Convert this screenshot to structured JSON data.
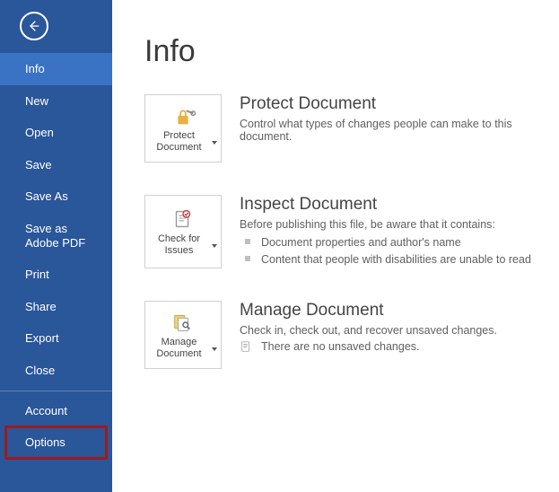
{
  "sidebar": {
    "items": [
      {
        "label": "Info",
        "selected": true
      },
      {
        "label": "New"
      },
      {
        "label": "Open"
      },
      {
        "label": "Save"
      },
      {
        "label": "Save As"
      },
      {
        "label": "Save as Adobe PDF"
      },
      {
        "label": "Print"
      },
      {
        "label": "Share"
      },
      {
        "label": "Export"
      },
      {
        "label": "Close"
      }
    ],
    "footer_items": [
      {
        "label": "Account"
      },
      {
        "label": "Options",
        "highlight": true
      }
    ]
  },
  "page": {
    "title": "Info"
  },
  "sections": {
    "protect": {
      "tile_label": "Protect Document",
      "title": "Protect Document",
      "desc": "Control what types of changes people can make to this document."
    },
    "inspect": {
      "tile_label": "Check for Issues",
      "title": "Inspect Document",
      "desc": "Before publishing this file, be aware that it contains:",
      "bullets": [
        "Document properties and author's name",
        "Content that people with disabilities are unable to read"
      ]
    },
    "manage": {
      "tile_label": "Manage Document",
      "title": "Manage Document",
      "desc": "Check in, check out, and recover unsaved changes.",
      "status": "There are no unsaved changes."
    }
  }
}
